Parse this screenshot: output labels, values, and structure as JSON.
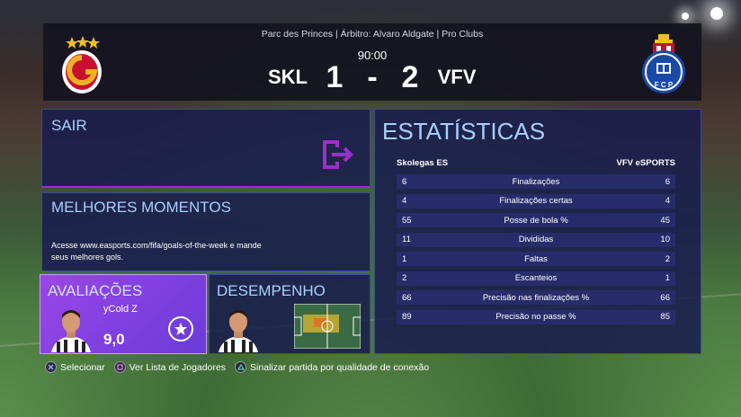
{
  "match": {
    "info": "Parc des Princes | Árbitro: Alvaro Aldgate | Pro Clubs",
    "clock": "90:00",
    "home_abbr": "SKL",
    "home_score": "1",
    "separator": "-",
    "away_score": "2",
    "away_abbr": "VFV"
  },
  "menu": {
    "sair_label": "SAIR",
    "melhores_label": "MELHORES MOMENTOS",
    "melhores_desc": "Acesse www.easports.com/fifa/goals-of-the-week e mande seus melhores gols.",
    "avaliacoes_label": "AVALIAÇÕES",
    "player_name": "yCold Z",
    "rating": "9,0",
    "desempenho_label": "DESEMPENHO"
  },
  "stats": {
    "title": "ESTATÍSTICAS",
    "home_team": "Skolegas ES",
    "away_team": "VFV eSPORTS",
    "rows": [
      {
        "home": "6",
        "label": "Finalizações",
        "away": "6"
      },
      {
        "home": "4",
        "label": "Finalizações certas",
        "away": "4"
      },
      {
        "home": "55",
        "label": "Posse de bola %",
        "away": "45"
      },
      {
        "home": "11",
        "label": "Divididas",
        "away": "10"
      },
      {
        "home": "1",
        "label": "Faltas",
        "away": "2"
      },
      {
        "home": "2",
        "label": "Escanteios",
        "away": "1"
      },
      {
        "home": "66",
        "label": "Precisão nas finalizações %",
        "away": "66"
      },
      {
        "home": "89",
        "label": "Precisão no passe %",
        "away": "85"
      }
    ]
  },
  "hints": {
    "select": "Selecionar",
    "players": "Ver Lista de Jogadores",
    "report": "Sinalizar partida por qualidade de conexão"
  },
  "colors": {
    "accent": "#a8d0ff",
    "panel": "#181c4e",
    "highlight": "#9a47e6",
    "exit_icon": "#9b2fc8"
  },
  "icons": {
    "home_crest": "galatasaray-crest-icon",
    "away_crest": "porto-crest-icon",
    "exit": "exit-icon",
    "star": "star-icon",
    "cross": "cross-button-icon",
    "square": "square-button-icon",
    "triangle": "triangle-button-icon"
  }
}
